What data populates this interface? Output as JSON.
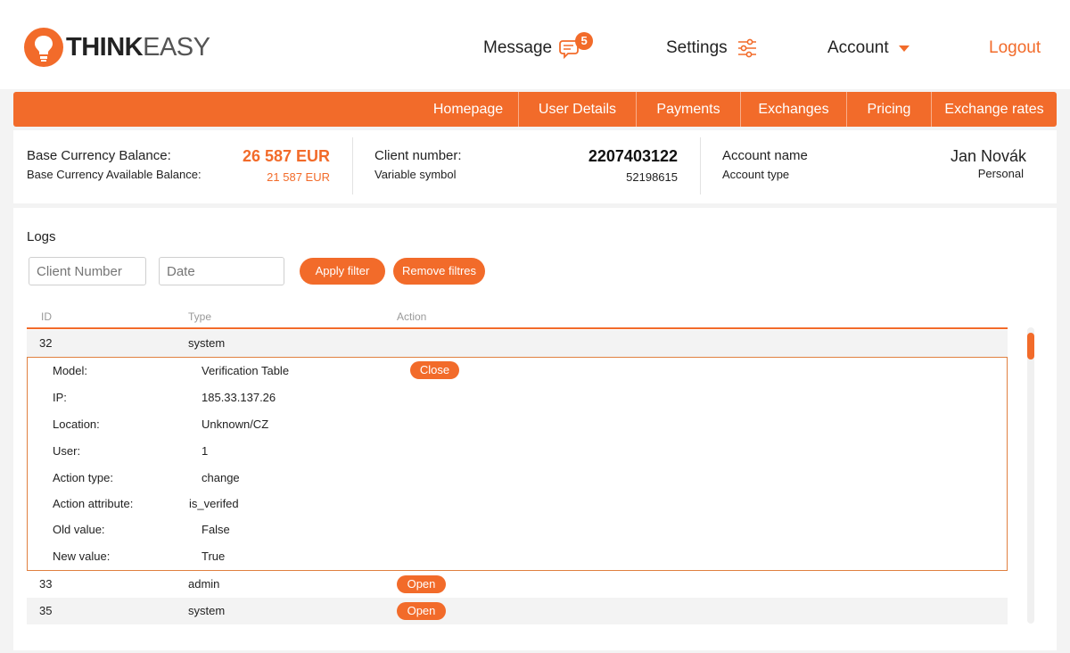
{
  "colors": {
    "accent": "#f26b2a",
    "panel": "#ffffff",
    "background": "#f3f3f3"
  },
  "logo": {
    "bold": "THINK",
    "light": "EASY"
  },
  "header": {
    "message": "Message",
    "message_count": "5",
    "settings": "Settings",
    "account": "Account",
    "logout": "Logout"
  },
  "menu": [
    "Homepage",
    "User Details",
    "Payments",
    "Exchanges",
    "Pricing",
    "Exchange rates"
  ],
  "balance": {
    "base_label": "Base Currency Balance:",
    "base_value": "26 587 EUR",
    "available_label": "Base Currency Available Balance:",
    "available_value": "21 587 EUR",
    "client_label": "Client number:",
    "client_value": "2207403122",
    "variable_label": "Variable symbol",
    "variable_value": "52198615",
    "account_name_label": "Account name",
    "account_name_value": "Jan Novák",
    "account_type_label": "Account type",
    "account_type_value": "Personal"
  },
  "logs": {
    "title": "Logs",
    "client_placeholder": "Client Number",
    "date_placeholder": "Date",
    "apply_label": "Apply filter",
    "remove_label": "Remove filtres",
    "columns": [
      "ID",
      "Type",
      "Action"
    ],
    "rows": [
      {
        "id": "32",
        "type": "system",
        "action": "Close"
      },
      {
        "id": "33",
        "type": "admin",
        "action": "Open"
      },
      {
        "id": "35",
        "type": "system",
        "action": "Open"
      }
    ],
    "details": [
      {
        "label": "Model:",
        "value": "Verification Table"
      },
      {
        "label": "IP:",
        "value": "185.33.137.26"
      },
      {
        "label": "Location:",
        "value": "Unknown/CZ"
      },
      {
        "label": "User:",
        "value": "1"
      },
      {
        "label": "Action type:",
        "value": "change"
      },
      {
        "label": "Action attribute:",
        "value": "is_verifed"
      },
      {
        "label": "Old value:",
        "value": "False"
      },
      {
        "label": "New value:",
        "value": "True"
      }
    ]
  }
}
